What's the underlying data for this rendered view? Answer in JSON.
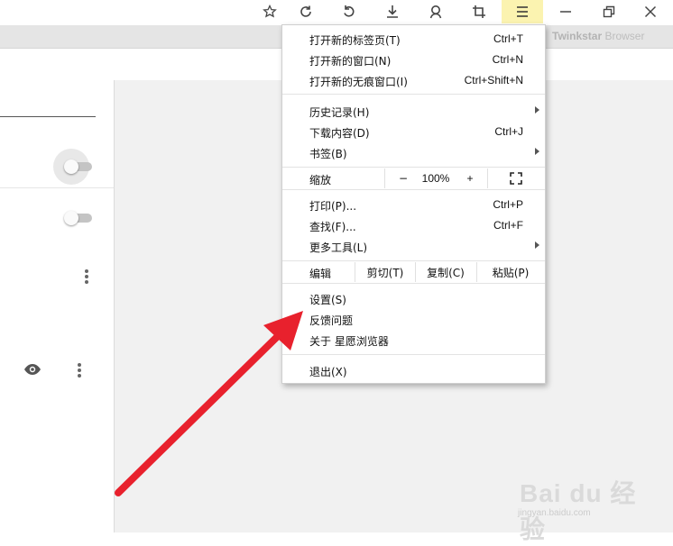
{
  "brand": {
    "name": "Twinkstar",
    "suffix": " Browser"
  },
  "toolbar": {
    "icons": {
      "bookmark": "☆",
      "refresh": "↻",
      "undo": "↶",
      "download": "⤓",
      "account": "person",
      "crop": "⌗",
      "menu": "≡",
      "minimize": "—",
      "restore": "❐",
      "close": "✕"
    }
  },
  "menu": {
    "new_tab": {
      "label": "打开新的标签页(T)",
      "shortcut": "Ctrl+T"
    },
    "new_window": {
      "label": "打开新的窗口(N)",
      "shortcut": "Ctrl+N"
    },
    "new_incognito": {
      "label": "打开新的无痕窗口(I)",
      "shortcut": "Ctrl+Shift+N"
    },
    "history": {
      "label": "历史记录(H)"
    },
    "downloads": {
      "label": "下载内容(D)",
      "shortcut": "Ctrl+J"
    },
    "bookmarks": {
      "label": "书签(B)"
    },
    "zoom": {
      "label": "缩放",
      "minus": "−",
      "value": "100%",
      "plus": "+",
      "fullscreen_icon": "fullscreen-icon"
    },
    "print": {
      "label": "打印(P)...",
      "shortcut": "Ctrl+P"
    },
    "find": {
      "label": "查找(F)...",
      "shortcut": "Ctrl+F"
    },
    "more_tools": {
      "label": "更多工具(L)"
    },
    "edit": {
      "label": "编辑",
      "cut": "剪切(T)",
      "copy": "复制(C)",
      "paste": "粘贴(P)"
    },
    "settings": {
      "label": "设置(S)"
    },
    "feedback": {
      "label": "反馈问题"
    },
    "about": {
      "label": "关于 星愿浏览器"
    },
    "exit": {
      "label": "退出(X)"
    }
  },
  "watermark": {
    "logo": "Bai du 经验",
    "url": "jingyan.baidu.com"
  },
  "colors": {
    "arrow": "#e8212d",
    "menu_active_bg": "#fbf3b0"
  }
}
